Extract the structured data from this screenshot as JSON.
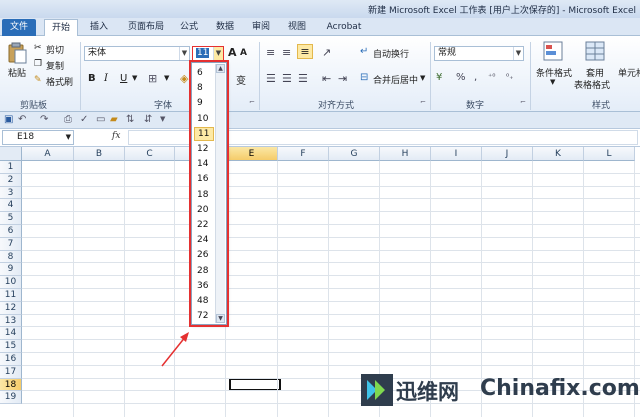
{
  "window": {
    "title": "新建 Microsoft Excel 工作表 [用户上次保存的] - Microsoft Excel"
  },
  "tabs": [
    "文件",
    "开始",
    "插入",
    "页面布局",
    "公式",
    "数据",
    "审阅",
    "视图",
    "Acrobat"
  ],
  "clipboard": {
    "paste": "粘贴",
    "cut": "剪切",
    "copy": "复制",
    "format_painter": "格式刷",
    "group": "剪贴板"
  },
  "font": {
    "name": "宋体",
    "size": "11",
    "group": "字体",
    "grow": "A",
    "shrink": "A",
    "bold": "B",
    "italic": "I",
    "underline": "U"
  },
  "alignment": {
    "wrap": "自动换行",
    "merge": "合并后居中",
    "group": "对齐方式"
  },
  "number": {
    "format": "常规",
    "group": "数字"
  },
  "styles": {
    "conditional": "条件格式",
    "table1": "套用",
    "table2": "表格格式",
    "cell": "单元格",
    "group": "样式"
  },
  "formula_bar": {
    "name_box": "E18",
    "fx": "fx",
    "value": ""
  },
  "columns": [
    "A",
    "B",
    "C",
    "D",
    "E",
    "F",
    "G",
    "H",
    "I",
    "J",
    "K",
    "L"
  ],
  "rows": [
    "1",
    "2",
    "3",
    "4",
    "5",
    "6",
    "7",
    "8",
    "9",
    "10",
    "11",
    "12",
    "13",
    "14",
    "15",
    "16",
    "17",
    "18",
    "19"
  ],
  "selected": {
    "column": "E",
    "row": "18"
  },
  "font_size_options": [
    "6",
    "8",
    "9",
    "10",
    "11",
    "12",
    "14",
    "16",
    "18",
    "20",
    "22",
    "24",
    "26",
    "28",
    "36",
    "48",
    "72"
  ],
  "font_size_selected": "11",
  "watermark": {
    "cn": "迅维网",
    "en": "Chinafix.com"
  },
  "colors": {
    "file_tab": "#2a6db8",
    "highlight": "#e53030",
    "selected_header": "#f5cc6a"
  }
}
